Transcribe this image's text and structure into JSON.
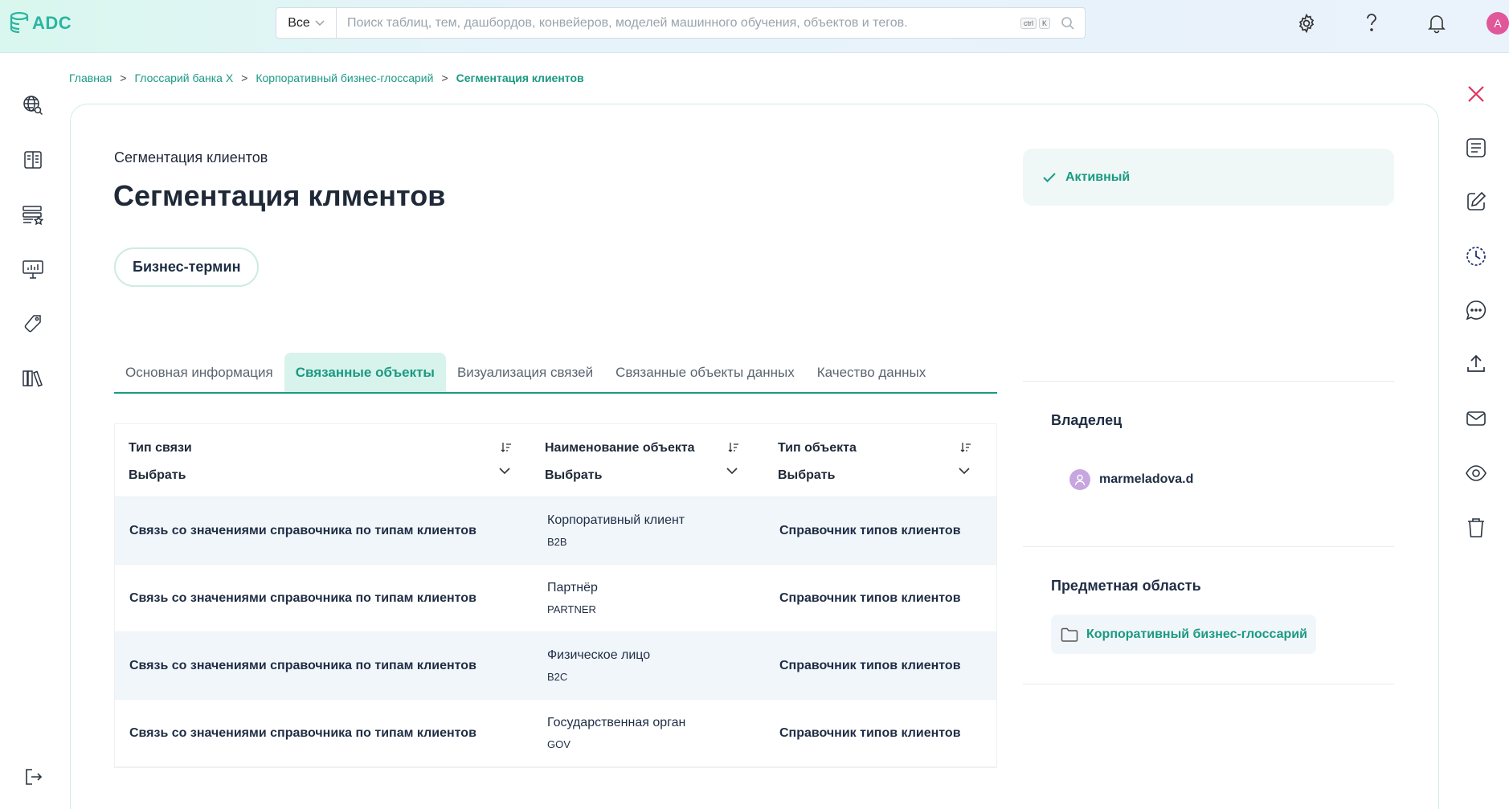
{
  "app": {
    "logo_text": "ADC"
  },
  "search": {
    "scope": "Все",
    "placeholder": "Поиск таблиц, тем, дашбордов, конвейеров, моделей машинного обучения, объектов и тегов.",
    "shortcut_ctrl": "ctrl",
    "shortcut_key": "K"
  },
  "user": {
    "avatar_letter": "A"
  },
  "breadcrumb": {
    "items": [
      "Главная",
      "Глоссарий банка X",
      "Корпоративный бизнес-глоссарий"
    ],
    "current": "Сегментация клиентов",
    "separator": ">"
  },
  "term": {
    "subtitle": "Сегментация клиентов",
    "title": "Сегментация клментов",
    "type_badge": "Бизнес-термин"
  },
  "tabs": [
    {
      "label": "Основная информация",
      "active": false
    },
    {
      "label": "Связанные объекты",
      "active": true
    },
    {
      "label": "Визуализация связей",
      "active": false
    },
    {
      "label": "Связанные объекты данных",
      "active": false
    },
    {
      "label": "Качество данных",
      "active": false
    }
  ],
  "table": {
    "columns": [
      {
        "label": "Тип связи",
        "filter": "Выбрать"
      },
      {
        "label": "Наименование объекта",
        "filter": "Выбрать"
      },
      {
        "label": "Тип объекта",
        "filter": "Выбрать"
      }
    ],
    "rows": [
      {
        "link_type": "Связь со значениями справочника по типам клиентов",
        "object_name": "Корпоративный клиент",
        "object_code": "B2B",
        "object_type": "Справочник типов клиентов"
      },
      {
        "link_type": "Связь со значениями справочника по типам клиентов",
        "object_name": "Партнёр",
        "object_code": "PARTNER",
        "object_type": "Справочник типов клиентов"
      },
      {
        "link_type": "Связь со значениями справочника по типам клиентов",
        "object_name": "Физическое лицо",
        "object_code": "B2C",
        "object_type": "Справочник типов клиентов"
      },
      {
        "link_type": "Связь со значениями справочника по типам клиентов",
        "object_name": "Государственная орган",
        "object_code": "GOV",
        "object_type": "Справочник типов клиентов"
      }
    ]
  },
  "status": {
    "label": "Активный"
  },
  "owner": {
    "heading": "Владелец",
    "name": "marmeladova.d"
  },
  "domain": {
    "heading": "Предметная область",
    "name": "Корпоративный бизнес-глоссарий"
  },
  "colors": {
    "accent": "#1a9a82",
    "close": "#e0335a",
    "row_alt": "#f1f6fb",
    "avatar": "#e0579a"
  },
  "icons": {
    "top": [
      "settings-icon",
      "help-icon",
      "bell-icon"
    ],
    "left_nav": [
      "globe-search-icon",
      "glossary-book-icon",
      "data-catalog-icon",
      "dashboard-icon",
      "tag-icon",
      "library-icon",
      "logout-icon"
    ],
    "right_actions": [
      "close-icon",
      "document-icon",
      "edit-icon",
      "history-icon",
      "comment-icon",
      "upload-icon",
      "mail-icon",
      "eye-icon",
      "trash-icon"
    ]
  }
}
